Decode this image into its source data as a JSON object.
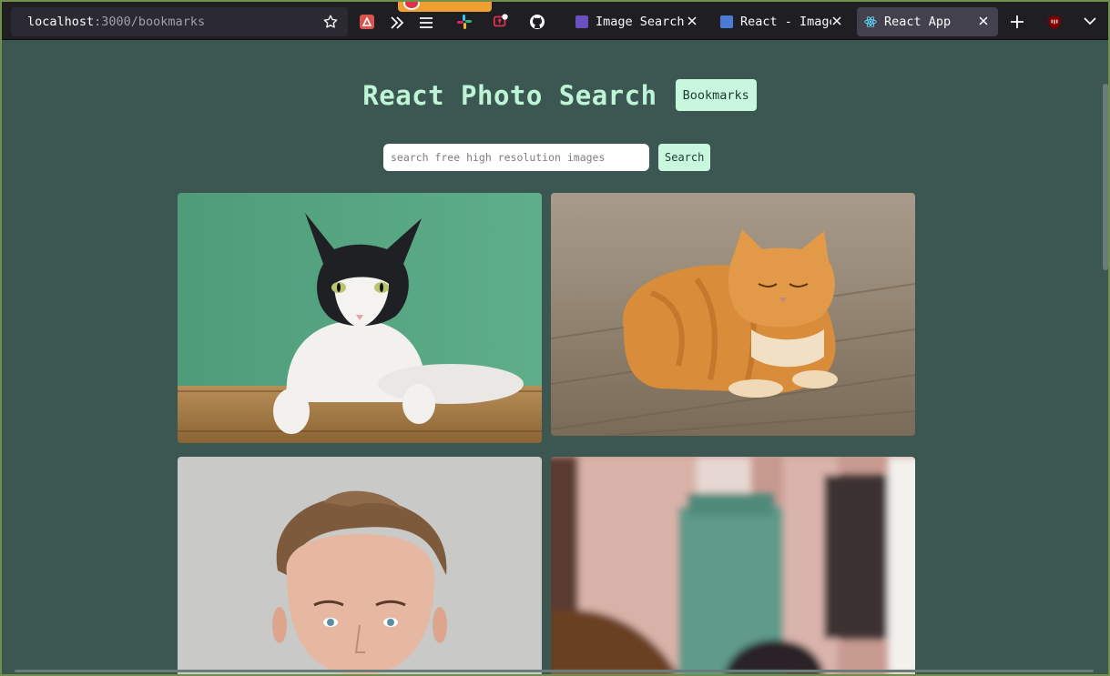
{
  "browser": {
    "url_host": "localhost",
    "url_rest": ":3000/bookmarks",
    "tabs": [
      {
        "title": "Image Search A",
        "favicon_color": "#6b4fbf",
        "active": false
      },
      {
        "title": "React - Image",
        "favicon_color": "#4a7bd6",
        "active": false
      },
      {
        "title": "React App",
        "favicon_color": "#61dafb",
        "active": true
      }
    ]
  },
  "page": {
    "title": "React Photo Search",
    "bookmarks_label": "Bookmarks",
    "search": {
      "placeholder": "search free high resolution images",
      "button_label": "Search"
    },
    "photos": [
      {
        "subject": "black-and-white cat on green background"
      },
      {
        "subject": "orange tabby cat lying on wooden floor"
      },
      {
        "subject": "portrait of young man"
      },
      {
        "subject": "blurred building with teal pillar"
      }
    ]
  },
  "colors": {
    "page_bg": "#3c5652",
    "accent": "#c8f7de",
    "title": "#bdf5d6",
    "chrome_bg": "#1f1f23"
  }
}
